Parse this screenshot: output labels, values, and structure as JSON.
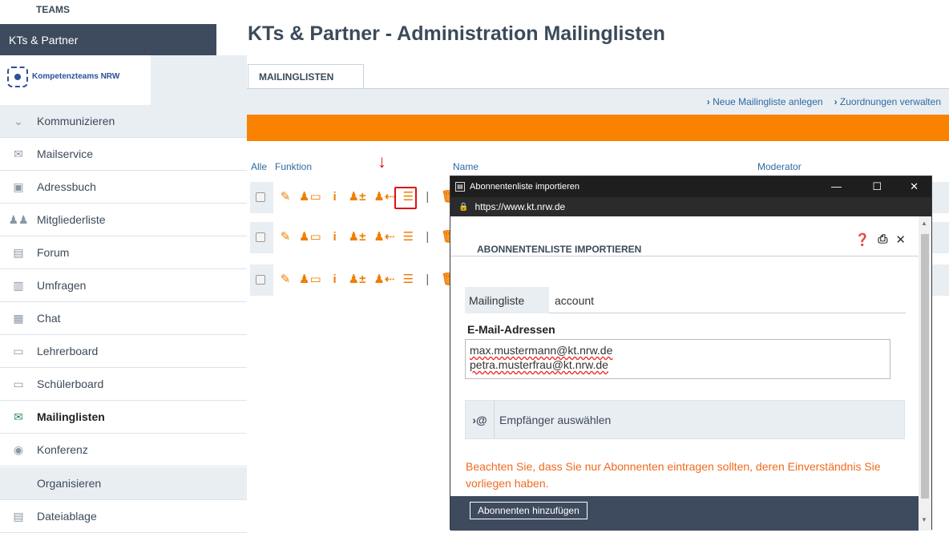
{
  "sidebar": {
    "teams_label": "TEAMS",
    "group_title": "KTs & Partner",
    "logo_text": "Kompetenzteams NRW",
    "items": [
      {
        "label": "Kommunizieren",
        "icon": "chevron-down-icon"
      },
      {
        "label": "Mailservice",
        "icon": "envelope-icon"
      },
      {
        "label": "Adressbuch",
        "icon": "address-book-icon"
      },
      {
        "label": "Mitgliederliste",
        "icon": "members-icon"
      },
      {
        "label": "Forum",
        "icon": "forum-icon"
      },
      {
        "label": "Umfragen",
        "icon": "poll-chart-icon"
      },
      {
        "label": "Chat",
        "icon": "chat-icon"
      },
      {
        "label": "Lehrerboard",
        "icon": "board-icon"
      },
      {
        "label": "Schülerboard",
        "icon": "board-icon"
      },
      {
        "label": "Mailinglisten",
        "icon": "mailinglist-icon"
      },
      {
        "label": "Konferenz",
        "icon": "conference-icon"
      },
      {
        "label": "Organisieren",
        "icon": ""
      },
      {
        "label": "Dateiablage",
        "icon": "file-storage-icon"
      }
    ]
  },
  "main": {
    "title": "KTs & Partner - Administration Mailinglisten",
    "tab": "MAILINGLISTEN",
    "links": {
      "new_list": "Neue Mailingliste anlegen",
      "assignments": "Zuordnungen verwalten"
    },
    "columns": {
      "all": "Alle",
      "function": "Funktion",
      "name": "Name",
      "moderator": "Moderator"
    },
    "row_icons": {
      "edit": "✎",
      "assign": "♟▭",
      "info": "i",
      "add_member": "♟±",
      "import": "♟⇠",
      "list": "☰",
      "sep": "|",
      "delete": "🗑"
    }
  },
  "popup": {
    "window_title": "Abonnentenliste importieren",
    "url": "https://www.kt.nrw.de",
    "header": "ABONNENTENLISTE IMPORTIEREN",
    "mailinglist_label": "Mailingliste",
    "mailinglist_value": "account",
    "emails_label": "E-Mail-Adressen",
    "emails": [
      "max.mustermann@kt.nrw.de",
      "petra.musterfrau@kt.nrw.de"
    ],
    "recipients_icon_text": "›@",
    "recipients_label": "Empfänger auswählen",
    "notice": "Beachten Sie, dass Sie nur Abonnenten eintragen sollten, deren Einverständnis Sie vorliegen haben.",
    "add_button": "Abonnenten hinzufügen"
  },
  "colors": {
    "accent": "#f98200",
    "sidebar_dark": "#3e4b5e",
    "highlight": "#dd1111"
  }
}
